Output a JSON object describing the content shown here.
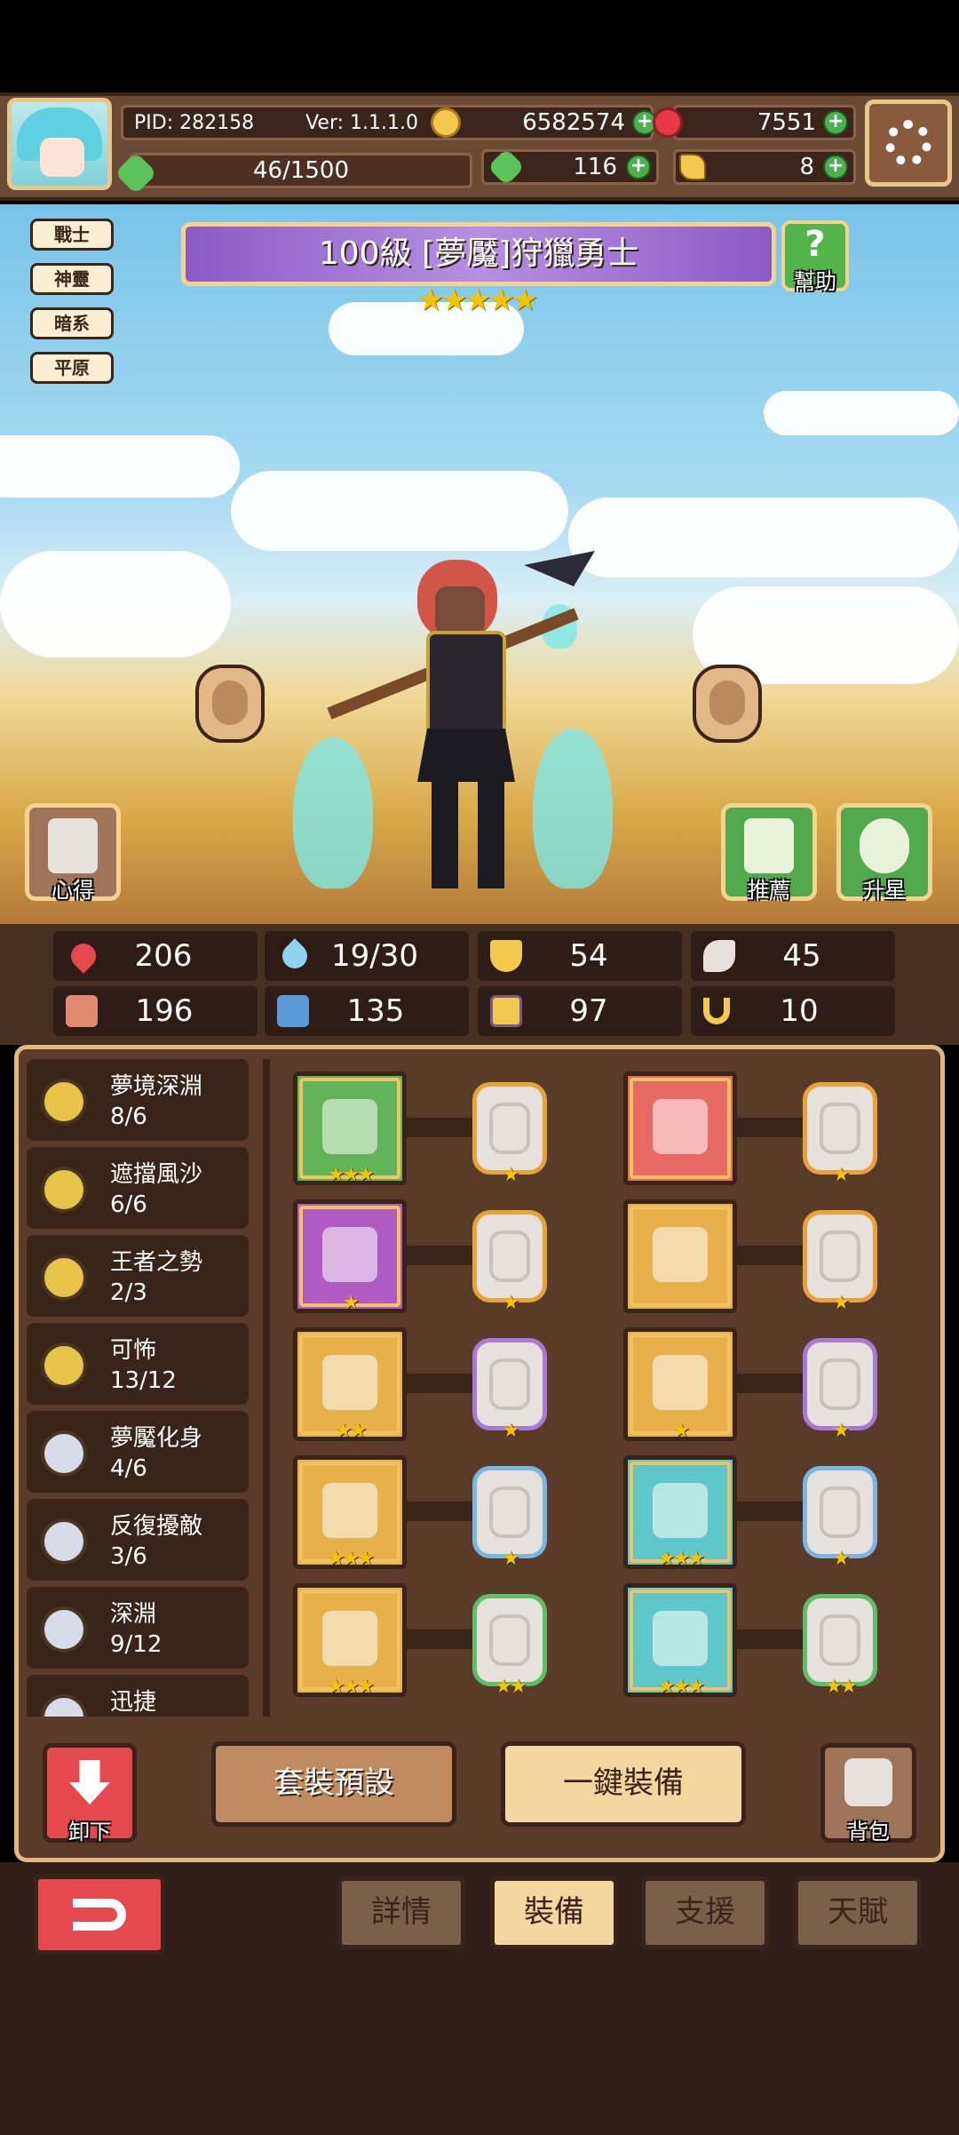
{
  "header": {
    "pid": "PID: 282158",
    "version": "Ver: 1.1.1.0",
    "gold": "6582574",
    "gems": "7551",
    "stamina": "46/1500",
    "clover": "116",
    "shards": "8"
  },
  "hero": {
    "level_name": "100級 [夢魘]狩獵勇士",
    "star_count": 5,
    "stars": "★★★★★",
    "tags": [
      "戰士",
      "神靈",
      "暗系",
      "平原"
    ],
    "help_label": "幫助",
    "insight_label": "心得",
    "recommend_label": "推薦",
    "upstar_label": "升星"
  },
  "stats": {
    "hp": "206",
    "mana": "19/30",
    "defense": "54",
    "speed": "45",
    "attack": "196",
    "magic": "135",
    "boots": "97",
    "luck": "10"
  },
  "sets": [
    {
      "name": "夢境深淵",
      "count": "8/6",
      "tier": "gold"
    },
    {
      "name": "遮擋風沙",
      "count": "6/6",
      "tier": "gold"
    },
    {
      "name": "王者之勢",
      "count": "2/3",
      "tier": "gold"
    },
    {
      "name": "可怖",
      "count": "13/12",
      "tier": "gold"
    },
    {
      "name": "夢魘化身",
      "count": "4/6",
      "tier": "silver"
    },
    {
      "name": "反復擾敵",
      "count": "3/6",
      "tier": "silver"
    },
    {
      "name": "深淵",
      "count": "9/12",
      "tier": "silver"
    },
    {
      "name": "迅捷",
      "count": "",
      "tier": "silver"
    }
  ],
  "equipment": [
    {
      "item": "spear-icon",
      "bg": "#62b45a",
      "stars": "★★★",
      "rune_color": "#e7a23a",
      "rune_stars": "★"
    },
    {
      "item": "straw-hat-icon",
      "bg": "#e86b63",
      "stars": "",
      "rune_color": "#e7a23a",
      "rune_stars": "★"
    },
    {
      "item": "blade-icon",
      "bg": "#b05bc4",
      "stars": "★",
      "rune_color": "#e7a23a",
      "rune_stars": "★"
    },
    {
      "item": "dark-armor-icon",
      "bg": "#e7b04a",
      "stars": "",
      "rune_color": "#e7a23a",
      "rune_stars": "★"
    },
    {
      "item": "heart-amulet-icon",
      "bg": "#e7b04a",
      "stars": "★★",
      "rune_color": "#a77ad6",
      "rune_stars": "★"
    },
    {
      "item": "dark-helmet-icon",
      "bg": "#e7b04a",
      "stars": "★",
      "rune_color": "#a77ad6",
      "rune_stars": "★"
    },
    {
      "item": "winged-charm-icon",
      "bg": "#e7b04a",
      "stars": "★★★",
      "rune_color": "#79b7e0",
      "rune_stars": "★"
    },
    {
      "item": "ring-icon",
      "bg": "#5fc7c9",
      "stars": "★★★",
      "rune_color": "#79b7e0",
      "rune_stars": "★"
    },
    {
      "item": "heart-pendant-icon",
      "bg": "#e7b04a",
      "stars": "★★★",
      "rune_color": "#5cbd6a",
      "rune_stars": "★★"
    },
    {
      "item": "boots-icon",
      "bg": "#5fc7c9",
      "stars": "★★★",
      "rune_color": "#5cbd6a",
      "rune_stars": "★★"
    }
  ],
  "actions": {
    "unequip": "卸下",
    "set_preset": "套裝預設",
    "auto_equip": "一鍵裝備",
    "bag": "背包"
  },
  "tabs": {
    "details": "詳情",
    "equipment": "裝備",
    "support": "支援",
    "talent": "天賦"
  },
  "colors": {
    "accent_gold": "#f3d38e",
    "panel_brown": "#5a3b2a",
    "back_red": "#e5484d",
    "banner_purple": "#8b5bc4"
  }
}
